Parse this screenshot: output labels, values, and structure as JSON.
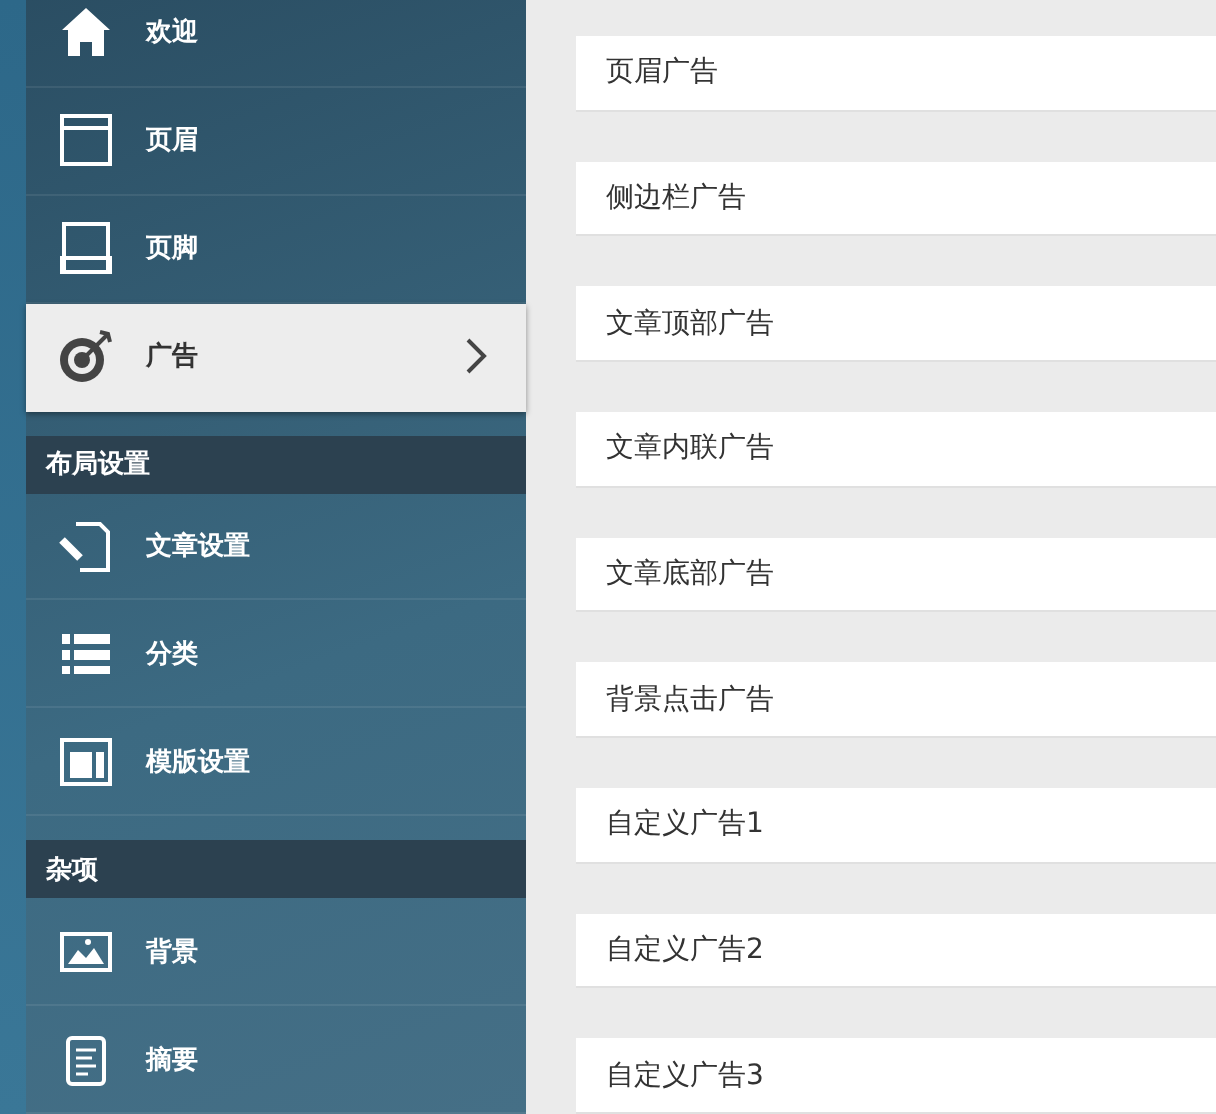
{
  "sidebar": {
    "groups": [
      {
        "items": [
          {
            "label": "欢迎",
            "selected": false
          },
          {
            "label": "页眉",
            "selected": false
          },
          {
            "label": "页脚",
            "selected": false
          },
          {
            "label": "广告",
            "selected": true
          }
        ]
      },
      {
        "title": "布局设置",
        "items": [
          {
            "label": "文章设置",
            "selected": false
          },
          {
            "label": "分类",
            "selected": false
          },
          {
            "label": "模版设置",
            "selected": false
          }
        ]
      },
      {
        "title": "杂项",
        "items": [
          {
            "label": "背景",
            "selected": false
          },
          {
            "label": "摘要",
            "selected": false
          }
        ]
      }
    ]
  },
  "panels": [
    "页眉广告",
    "侧边栏广告",
    "文章顶部广告",
    "文章内联广告",
    "文章底部广告",
    "背景点击广告",
    "自定义广告1",
    "自定义广告2",
    "自定义广告3"
  ]
}
